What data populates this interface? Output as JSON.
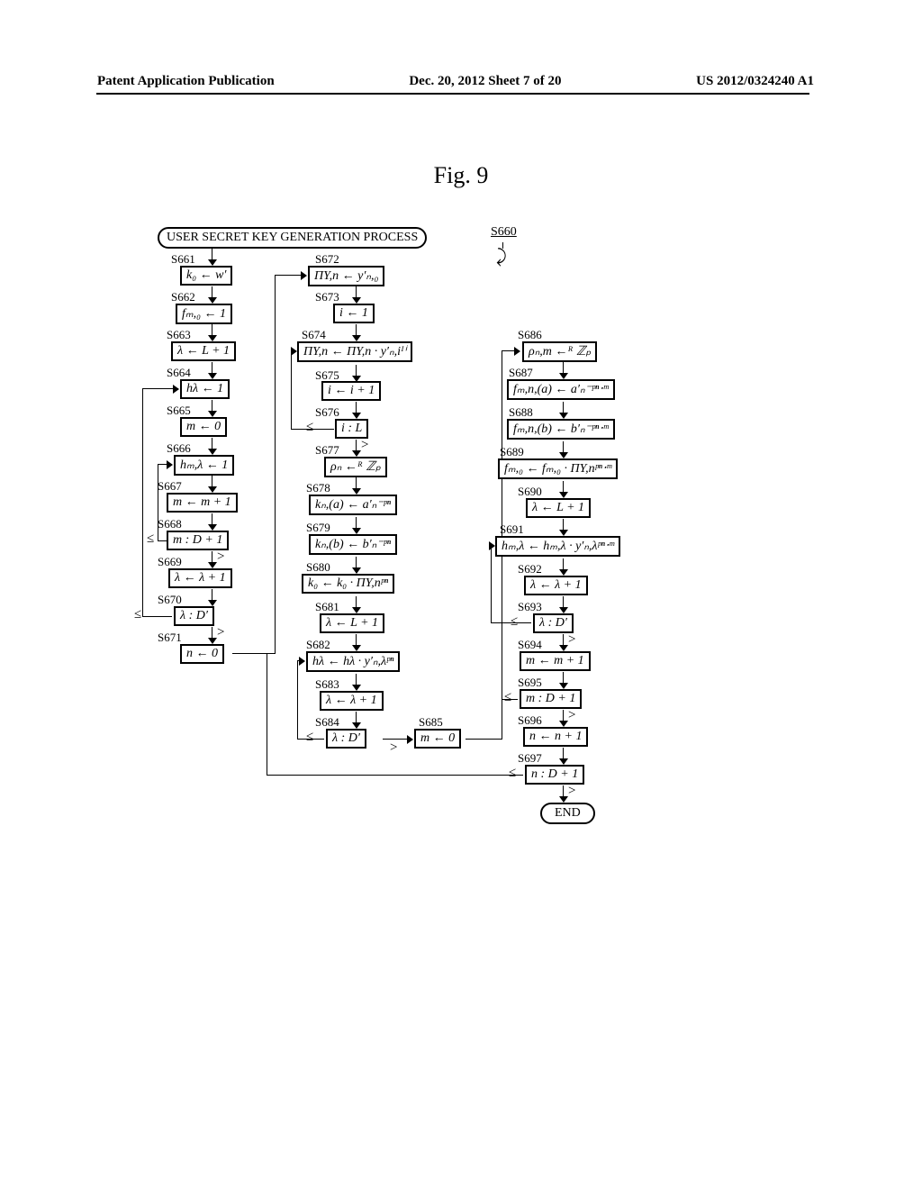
{
  "header": {
    "left": "Patent Application Publication",
    "center": "Dec. 20, 2012  Sheet 7 of 20",
    "right": "US 2012/0324240 A1"
  },
  "figure_title": "Fig. 9",
  "s660": "S660",
  "start_text": "USER SECRET KEY GENERATION PROCESS",
  "end_text": "END",
  "labels": {
    "s661": "S661",
    "s662": "S662",
    "s663": "S663",
    "s664": "S664",
    "s665": "S665",
    "s666": "S666",
    "s667": "S667",
    "s668": "S668",
    "s669": "S669",
    "s670": "S670",
    "s671": "S671",
    "s672": "S672",
    "s673": "S673",
    "s674": "S674",
    "s675": "S675",
    "s676": "S676",
    "s677": "S677",
    "s678": "S678",
    "s679": "S679",
    "s680": "S680",
    "s681": "S681",
    "s682": "S682",
    "s683": "S683",
    "s684": "S684",
    "s685": "S685",
    "s686": "S686",
    "s687": "S687",
    "s688": "S688",
    "s689": "S689",
    "s690": "S690",
    "s691": "S691",
    "s692": "S692",
    "s693": "S693",
    "s694": "S694",
    "s695": "S695",
    "s696": "S696",
    "s697": "S697"
  },
  "steps": {
    "s661": "k₀ ← w′",
    "s662": "fₘ​,₀ ← 1",
    "s663": "λ ← L + 1",
    "s664": "hλ ← 1",
    "s665": "m ← 0",
    "s666": "hₘ​,λ ← 1",
    "s667": "m ← m + 1",
    "s668": "m : D + 1",
    "s669": "λ ← λ + 1",
    "s670": "λ : D′",
    "s671": "n ← 0",
    "s672": "Π​Y,n ← y′ₙ​,₀",
    "s673": "i ← 1",
    "s674": "Π​Y,n ← Π​Y,n · y′ₙ,iᴵⁱ",
    "s675": "i ← i + 1",
    "s676": "i : L",
    "s677": "ρₙ ←ᴿ ℤₚ",
    "s678": "kₙ,(a) ← a′ₙ⁻ᵖⁿ",
    "s679": "kₙ,(b) ← b′ₙ⁻ᵖⁿ",
    "s680": "k₀ ← k₀ · Π​Y,nᵖⁿ",
    "s681": "λ ← L + 1",
    "s682": "hλ ← hλ · y′ₙ,λᵖⁿ",
    "s683": "λ ← λ + 1",
    "s684": "λ : D′",
    "s685": "m ← 0",
    "s686": "ρₙ,m ←ᴿ ℤₚ",
    "s687": "fₘ,n,(a) ← a′ₙ⁻ᵖⁿ‧ᵐ",
    "s688": "fₘ,n,(b) ← b′ₙ⁻ᵖⁿ‧ᵐ",
    "s689": "fₘ,₀ ← fₘ,₀ · Π​Y,nᵖⁿ‧ᵐ",
    "s690": "λ ← L + 1",
    "s691": "hₘ,λ ← hₘ,λ · y′ₙ,λᵖⁿ‧ᵐ",
    "s692": "λ ← λ + 1",
    "s693": "λ : D′",
    "s694": "m ← m + 1",
    "s695": "m : D + 1",
    "s696": "n ← n + 1",
    "s697": "n : D + 1"
  },
  "cmp": {
    "le": "≤",
    "gt": ">"
  }
}
